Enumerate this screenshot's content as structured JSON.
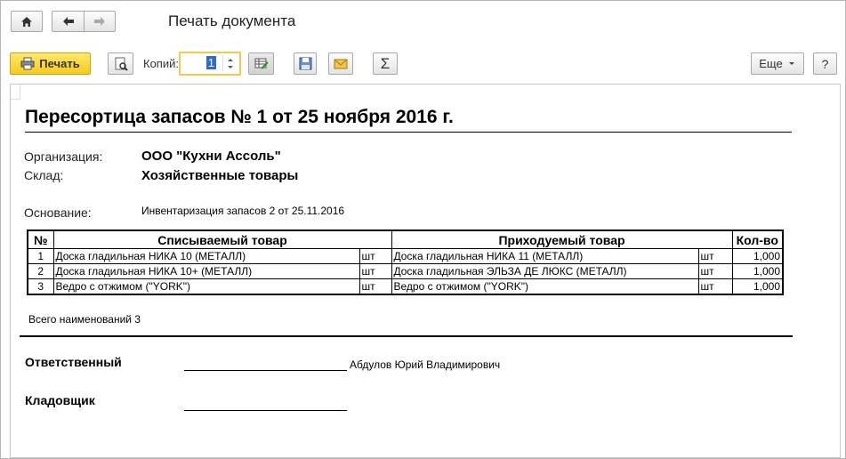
{
  "window": {
    "title": "Печать документа"
  },
  "toolbar": {
    "print_label": "Печать",
    "copies_label": "Копий:",
    "copies_value": "1",
    "more_label": "Еще",
    "help_label": "?"
  },
  "document": {
    "heading": "Пересортица запасов № 1 от 25 ноября 2016 г.",
    "org_label": "Организация:",
    "org_value": "ООО \"Кухни Ассоль\"",
    "warehouse_label": "Склад:",
    "warehouse_value": "Хозяйственные товары",
    "basis_label": "Основание:",
    "basis_value": "Инвентаризация запасов 2 от 25.11.2016",
    "table": {
      "headers": {
        "num": "№",
        "written_off": "Списываемый товар",
        "incoming": "Приходуемый товар",
        "qty": "Кол-во"
      },
      "rows": [
        {
          "num": "1",
          "from_item": "Доска гладильная  НИКА 10 (МЕТАЛЛ)",
          "from_unit": "шт",
          "to_item": "Доска гладильная  НИКА 11 (МЕТАЛЛ)",
          "to_unit": "шт",
          "qty": "1,000"
        },
        {
          "num": "2",
          "from_item": "Доска гладильная  НИКА 10+ (МЕТАЛЛ)",
          "from_unit": "шт",
          "to_item": "Доска гладильная  ЭЛЬЗА ДЕ ЛЮКС (МЕТАЛЛ)",
          "to_unit": "шт",
          "qty": "1,000"
        },
        {
          "num": "3",
          "from_item": "Ведро с отжимом (\"YORK\")",
          "from_unit": "шт",
          "to_item": "Ведро с отжимом (\"YORK\")",
          "to_unit": "шт",
          "qty": "1,000"
        }
      ]
    },
    "total_text": "Всего наименований 3",
    "responsible_label": "Ответственный",
    "responsible_name": "Абдулов Юрий Владимирович",
    "storekeeper_label": "Кладовщик"
  }
}
